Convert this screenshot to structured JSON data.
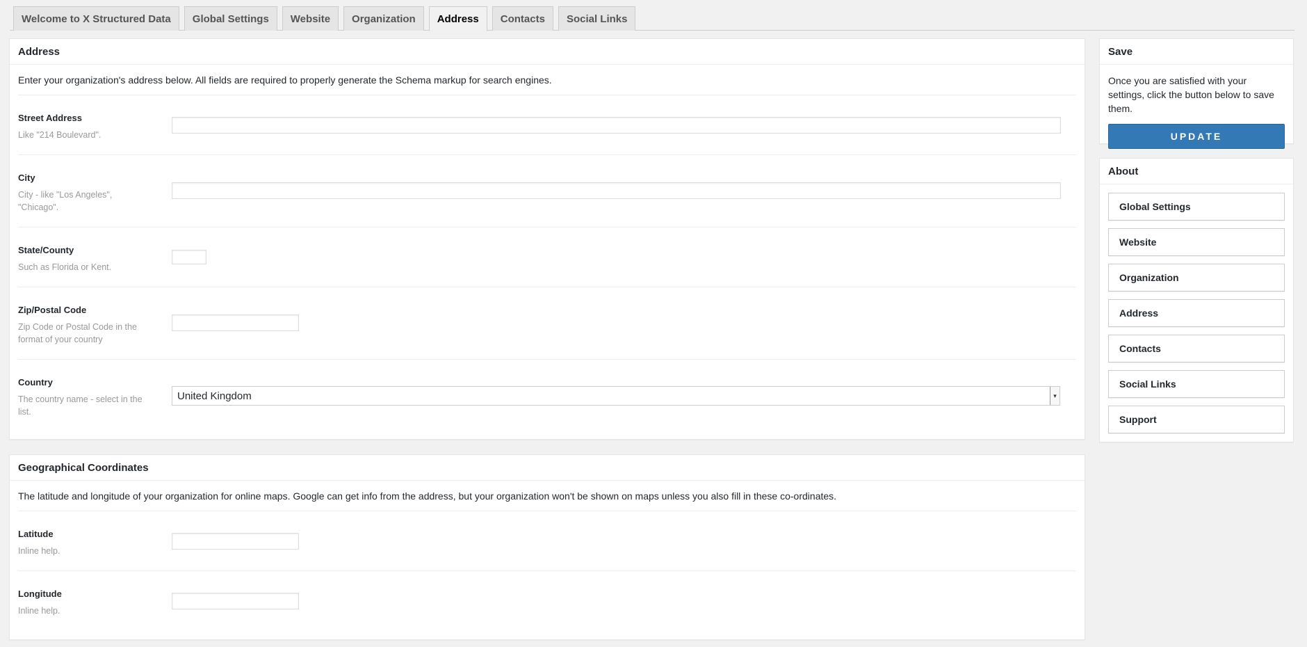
{
  "tabs": [
    {
      "label": "Welcome to X Structured Data"
    },
    {
      "label": "Global Settings"
    },
    {
      "label": "Website"
    },
    {
      "label": "Organization"
    },
    {
      "label": "Address"
    },
    {
      "label": "Contacts"
    },
    {
      "label": "Social Links"
    }
  ],
  "address": {
    "title": "Address",
    "description": "Enter your organization's address below. All fields are required to properly generate the Schema markup for search engines.",
    "fields": {
      "street": {
        "label": "Street Address",
        "hint": "Like \"214 Boulevard\".",
        "value": ""
      },
      "city": {
        "label": "City",
        "hint": "City - like \"Los Angeles\", \"Chicago\".",
        "value": ""
      },
      "state": {
        "label": "State/County",
        "hint": "Such as Florida or Kent.",
        "value": ""
      },
      "zip": {
        "label": "Zip/Postal Code",
        "hint": "Zip Code or Postal Code in the format of your country",
        "value": ""
      },
      "country": {
        "label": "Country",
        "hint": "The country name - select in the list.",
        "value": "United Kingdom"
      }
    }
  },
  "geo": {
    "title": "Geographical Coordinates",
    "description": "The latitude and longitude of your organization for online maps. Google can get info from the address, but your organization won't be shown on maps unless you also fill in these co-ordinates.",
    "fields": {
      "latitude": {
        "label": "Latitude",
        "hint": "Inline help.",
        "value": ""
      },
      "longitude": {
        "label": "Longitude",
        "hint": "Inline help.",
        "value": ""
      }
    }
  },
  "save": {
    "title": "Save",
    "text": "Once you are satisfied with your settings, click the button below to save them.",
    "button": "UPDATE"
  },
  "about": {
    "title": "About",
    "items": [
      "Global Settings",
      "Website",
      "Organization",
      "Address",
      "Contacts",
      "Social Links",
      "Support"
    ]
  },
  "colors": {
    "accent": "#3279b6",
    "background": "#f1f1f1"
  }
}
